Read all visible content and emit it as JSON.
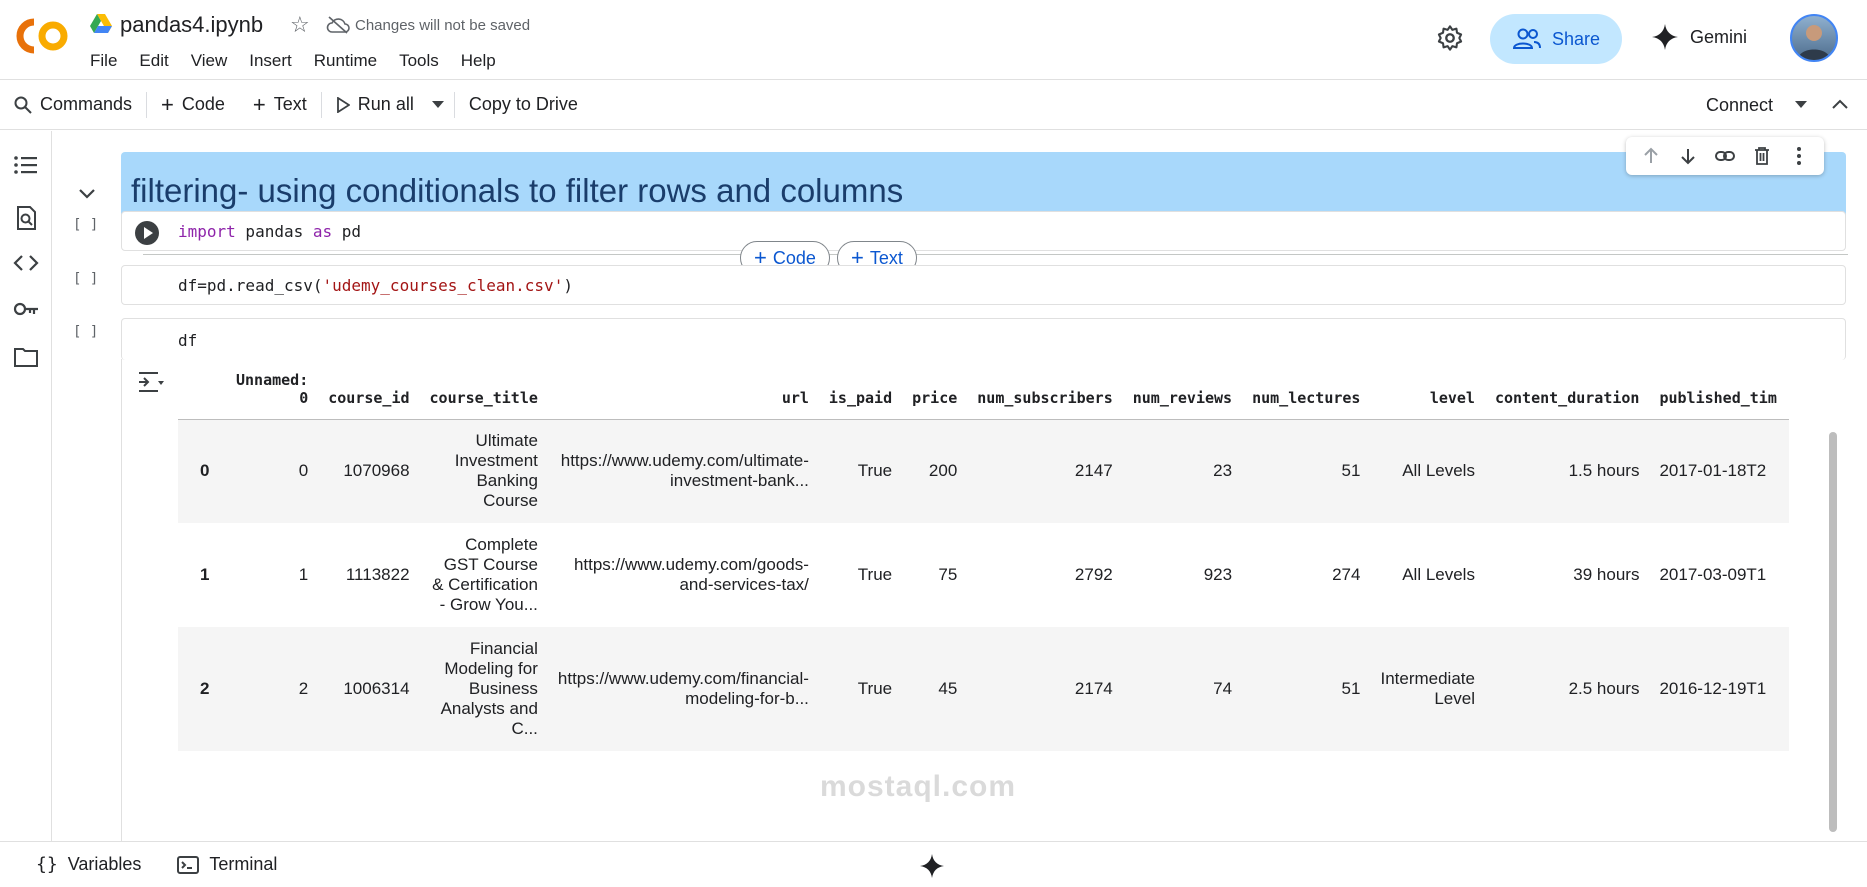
{
  "header": {
    "notebook_title": "pandas4.ipynb",
    "unsaved_text": "Changes will not be saved",
    "menu": [
      "File",
      "Edit",
      "View",
      "Insert",
      "Runtime",
      "Tools",
      "Help"
    ],
    "share_label": "Share",
    "gemini_label": "Gemini"
  },
  "toolbar": {
    "commands": "Commands",
    "code": "Code",
    "text": "Text",
    "run_all": "Run all",
    "copy_to_drive": "Copy to Drive",
    "connect": "Connect"
  },
  "cells": {
    "markdown_title": "filtering- using conditionals to filter rows and columns",
    "exec_count": "[ ]",
    "add_code": "Code",
    "add_text": "Text",
    "code1": {
      "kw1": "import",
      "mid": " pandas ",
      "kw2": "as",
      "end": " pd"
    },
    "code2": {
      "start": "df=pd.read_csv(",
      "str": "'udemy_courses_clean.csv'",
      "end": ")"
    },
    "code3": "df"
  },
  "table": {
    "columns": [
      "",
      "Unnamed: 0",
      "course_id",
      "course_title",
      "url",
      "is_paid",
      "price",
      "num_subscribers",
      "num_reviews",
      "num_lectures",
      "level",
      "content_duration",
      "published_tim"
    ],
    "rows": [
      [
        "0",
        "0",
        "1070968",
        "Ultimate Investment Banking Course",
        "https://www.udemy.com/ultimate-investment-bank...",
        "True",
        "200",
        "2147",
        "23",
        "51",
        "All Levels",
        "1.5 hours",
        "2017-01-18T2"
      ],
      [
        "1",
        "1",
        "1113822",
        "Complete GST Course & Certification - Grow You...",
        "https://www.udemy.com/goods-and-services-tax/",
        "True",
        "75",
        "2792",
        "923",
        "274",
        "All Levels",
        "39 hours",
        "2017-03-09T1"
      ],
      [
        "2",
        "2",
        "1006314",
        "Financial Modeling for Business Analysts and C...",
        "https://www.udemy.com/financial-modeling-for-b...",
        "True",
        "45",
        "2174",
        "74",
        "51",
        "Intermediate Level",
        "2.5 hours",
        "2016-12-19T1"
      ]
    ]
  },
  "footer": {
    "variables": "Variables",
    "terminal": "Terminal"
  },
  "watermark": "mostaql.com",
  "colors": {
    "header_cell_bg": "#a8d8fb",
    "share_bg": "#c2e7ff",
    "accent": "#0b57d0",
    "logo_orange": "#f9ab00",
    "logo_dark_orange": "#e8710a"
  }
}
